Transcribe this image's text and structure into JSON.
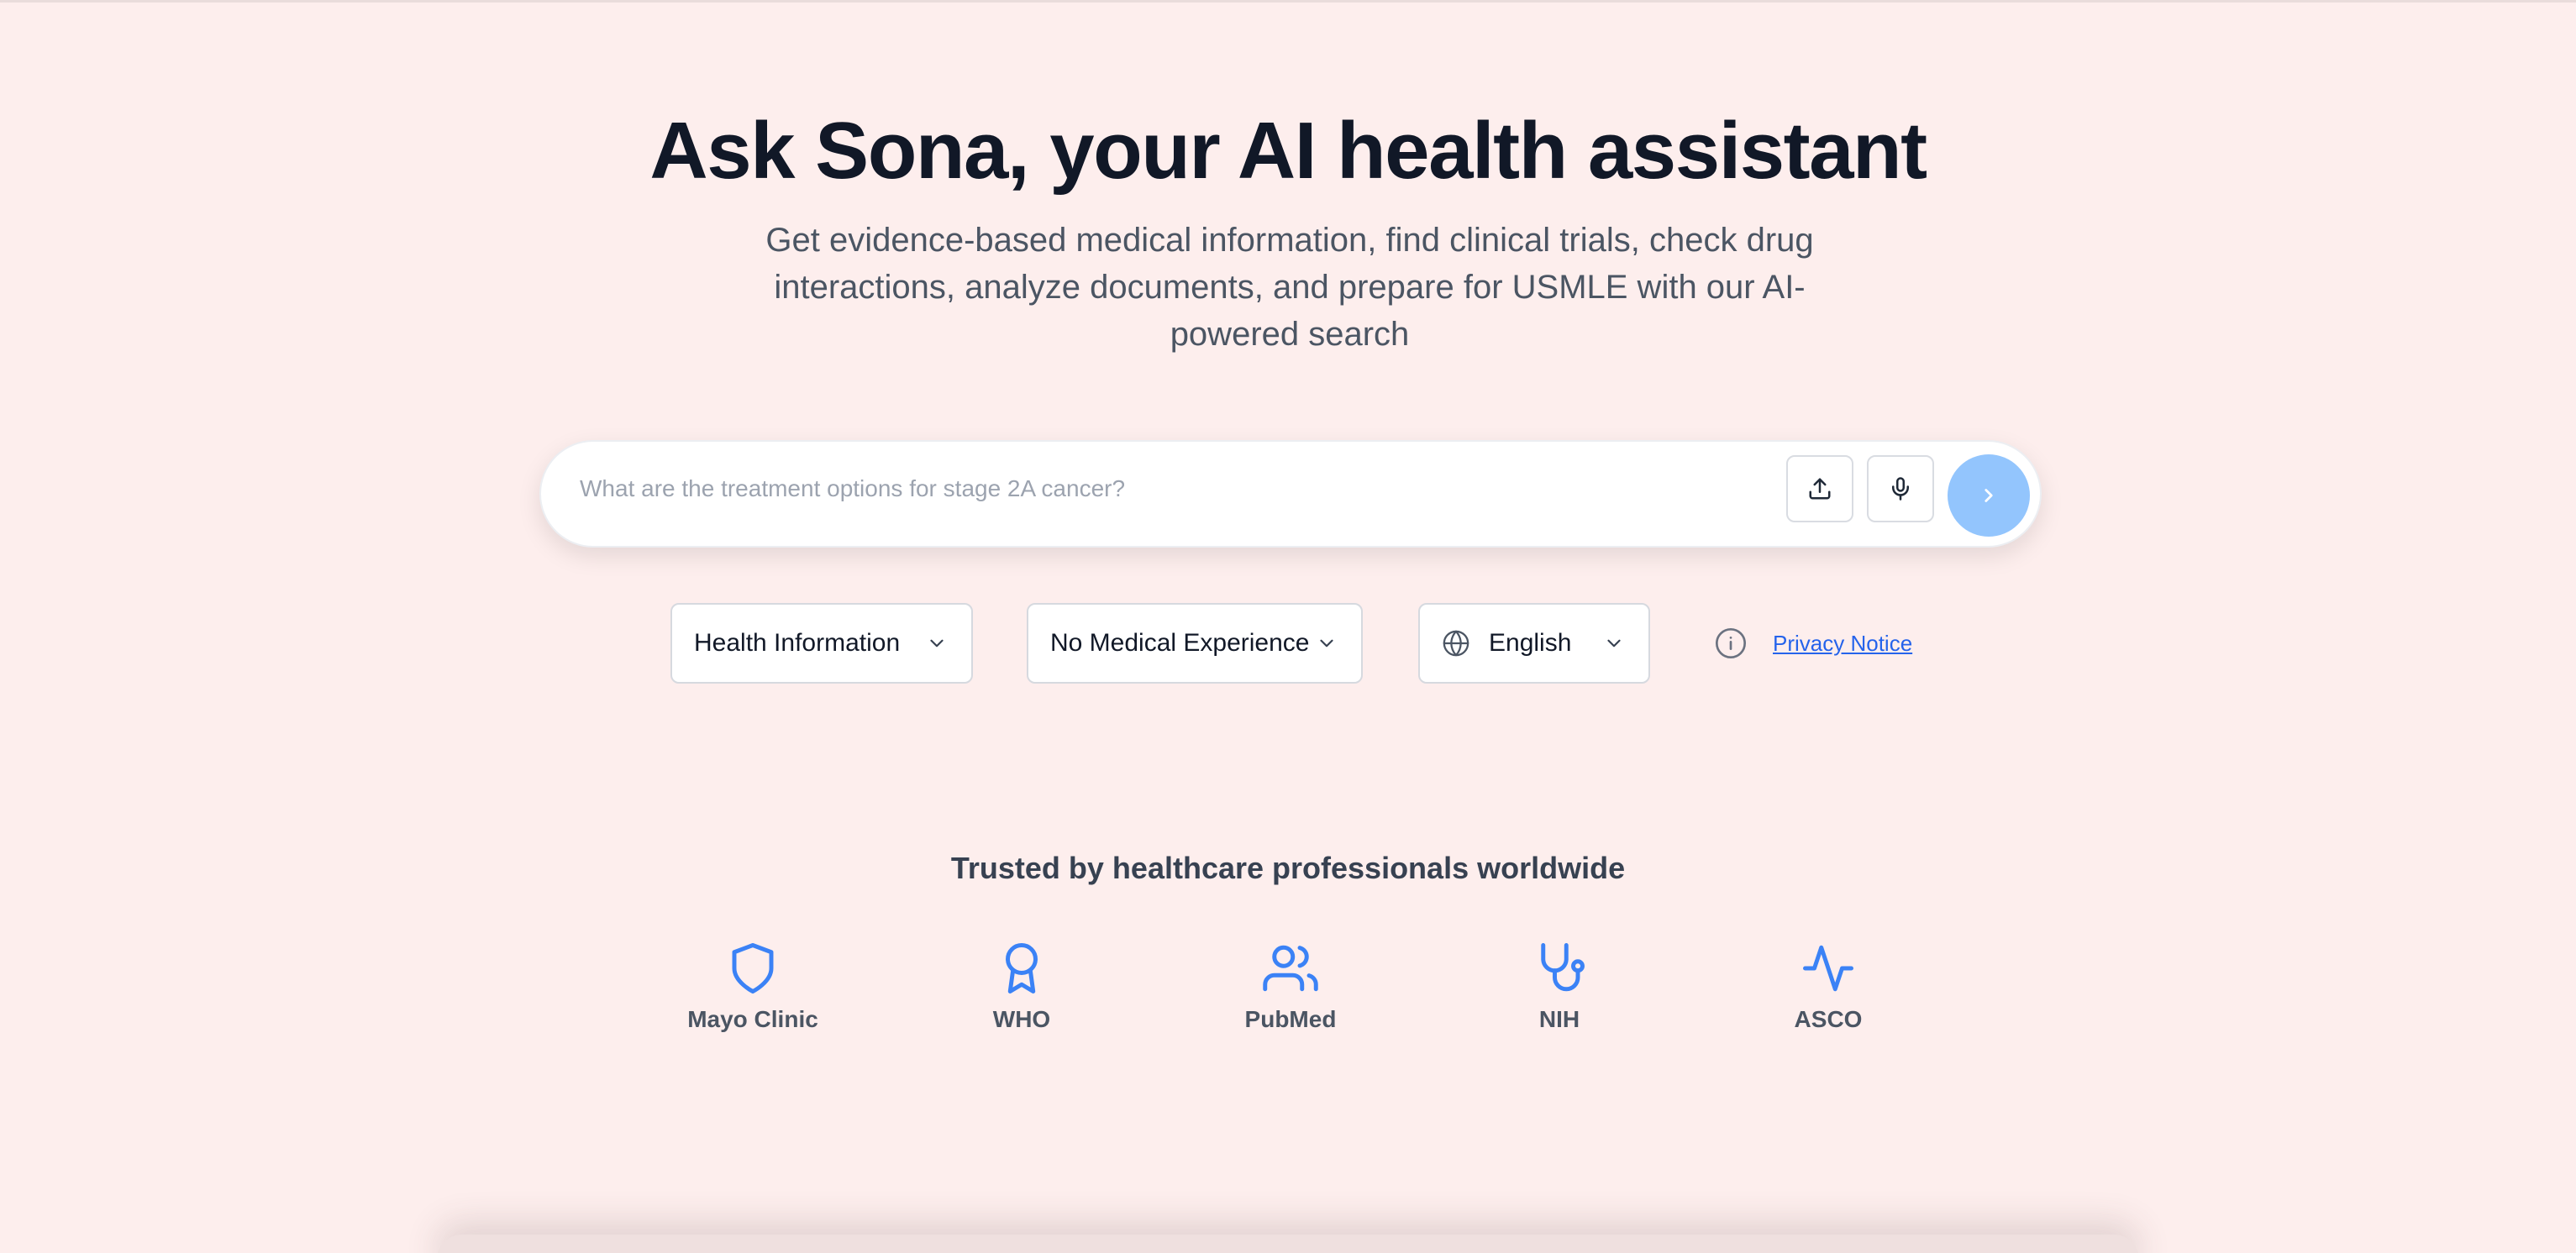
{
  "hero": {
    "title": "Ask Sona, your AI health assistant",
    "subtitle": "Get evidence-based medical information, find clinical trials, check drug interactions, analyze documents, and prepare for USMLE with our AI-powered search"
  },
  "search": {
    "placeholder": "What are the treatment options for stage 2A cancer?",
    "value": "",
    "upload_icon": "upload-icon",
    "mic_icon": "microphone-icon",
    "send_icon": "chevron-right-icon"
  },
  "filters": {
    "topic": "Health Information",
    "experience": "No Medical Experience",
    "language": "English"
  },
  "privacy": {
    "label": "Privacy Notice"
  },
  "trusted": {
    "heading": "Trusted by healthcare professionals worldwide",
    "partners": [
      {
        "name": "Mayo Clinic",
        "icon": "shield-icon"
      },
      {
        "name": "WHO",
        "icon": "award-icon"
      },
      {
        "name": "PubMed",
        "icon": "users-icon"
      },
      {
        "name": "NIH",
        "icon": "stethoscope-icon"
      },
      {
        "name": "ASCO",
        "icon": "activity-icon"
      }
    ]
  },
  "colors": {
    "background": "#fdeeed",
    "accent": "#3b82f6",
    "send_button": "#93c5fd",
    "link": "#2563eb"
  }
}
